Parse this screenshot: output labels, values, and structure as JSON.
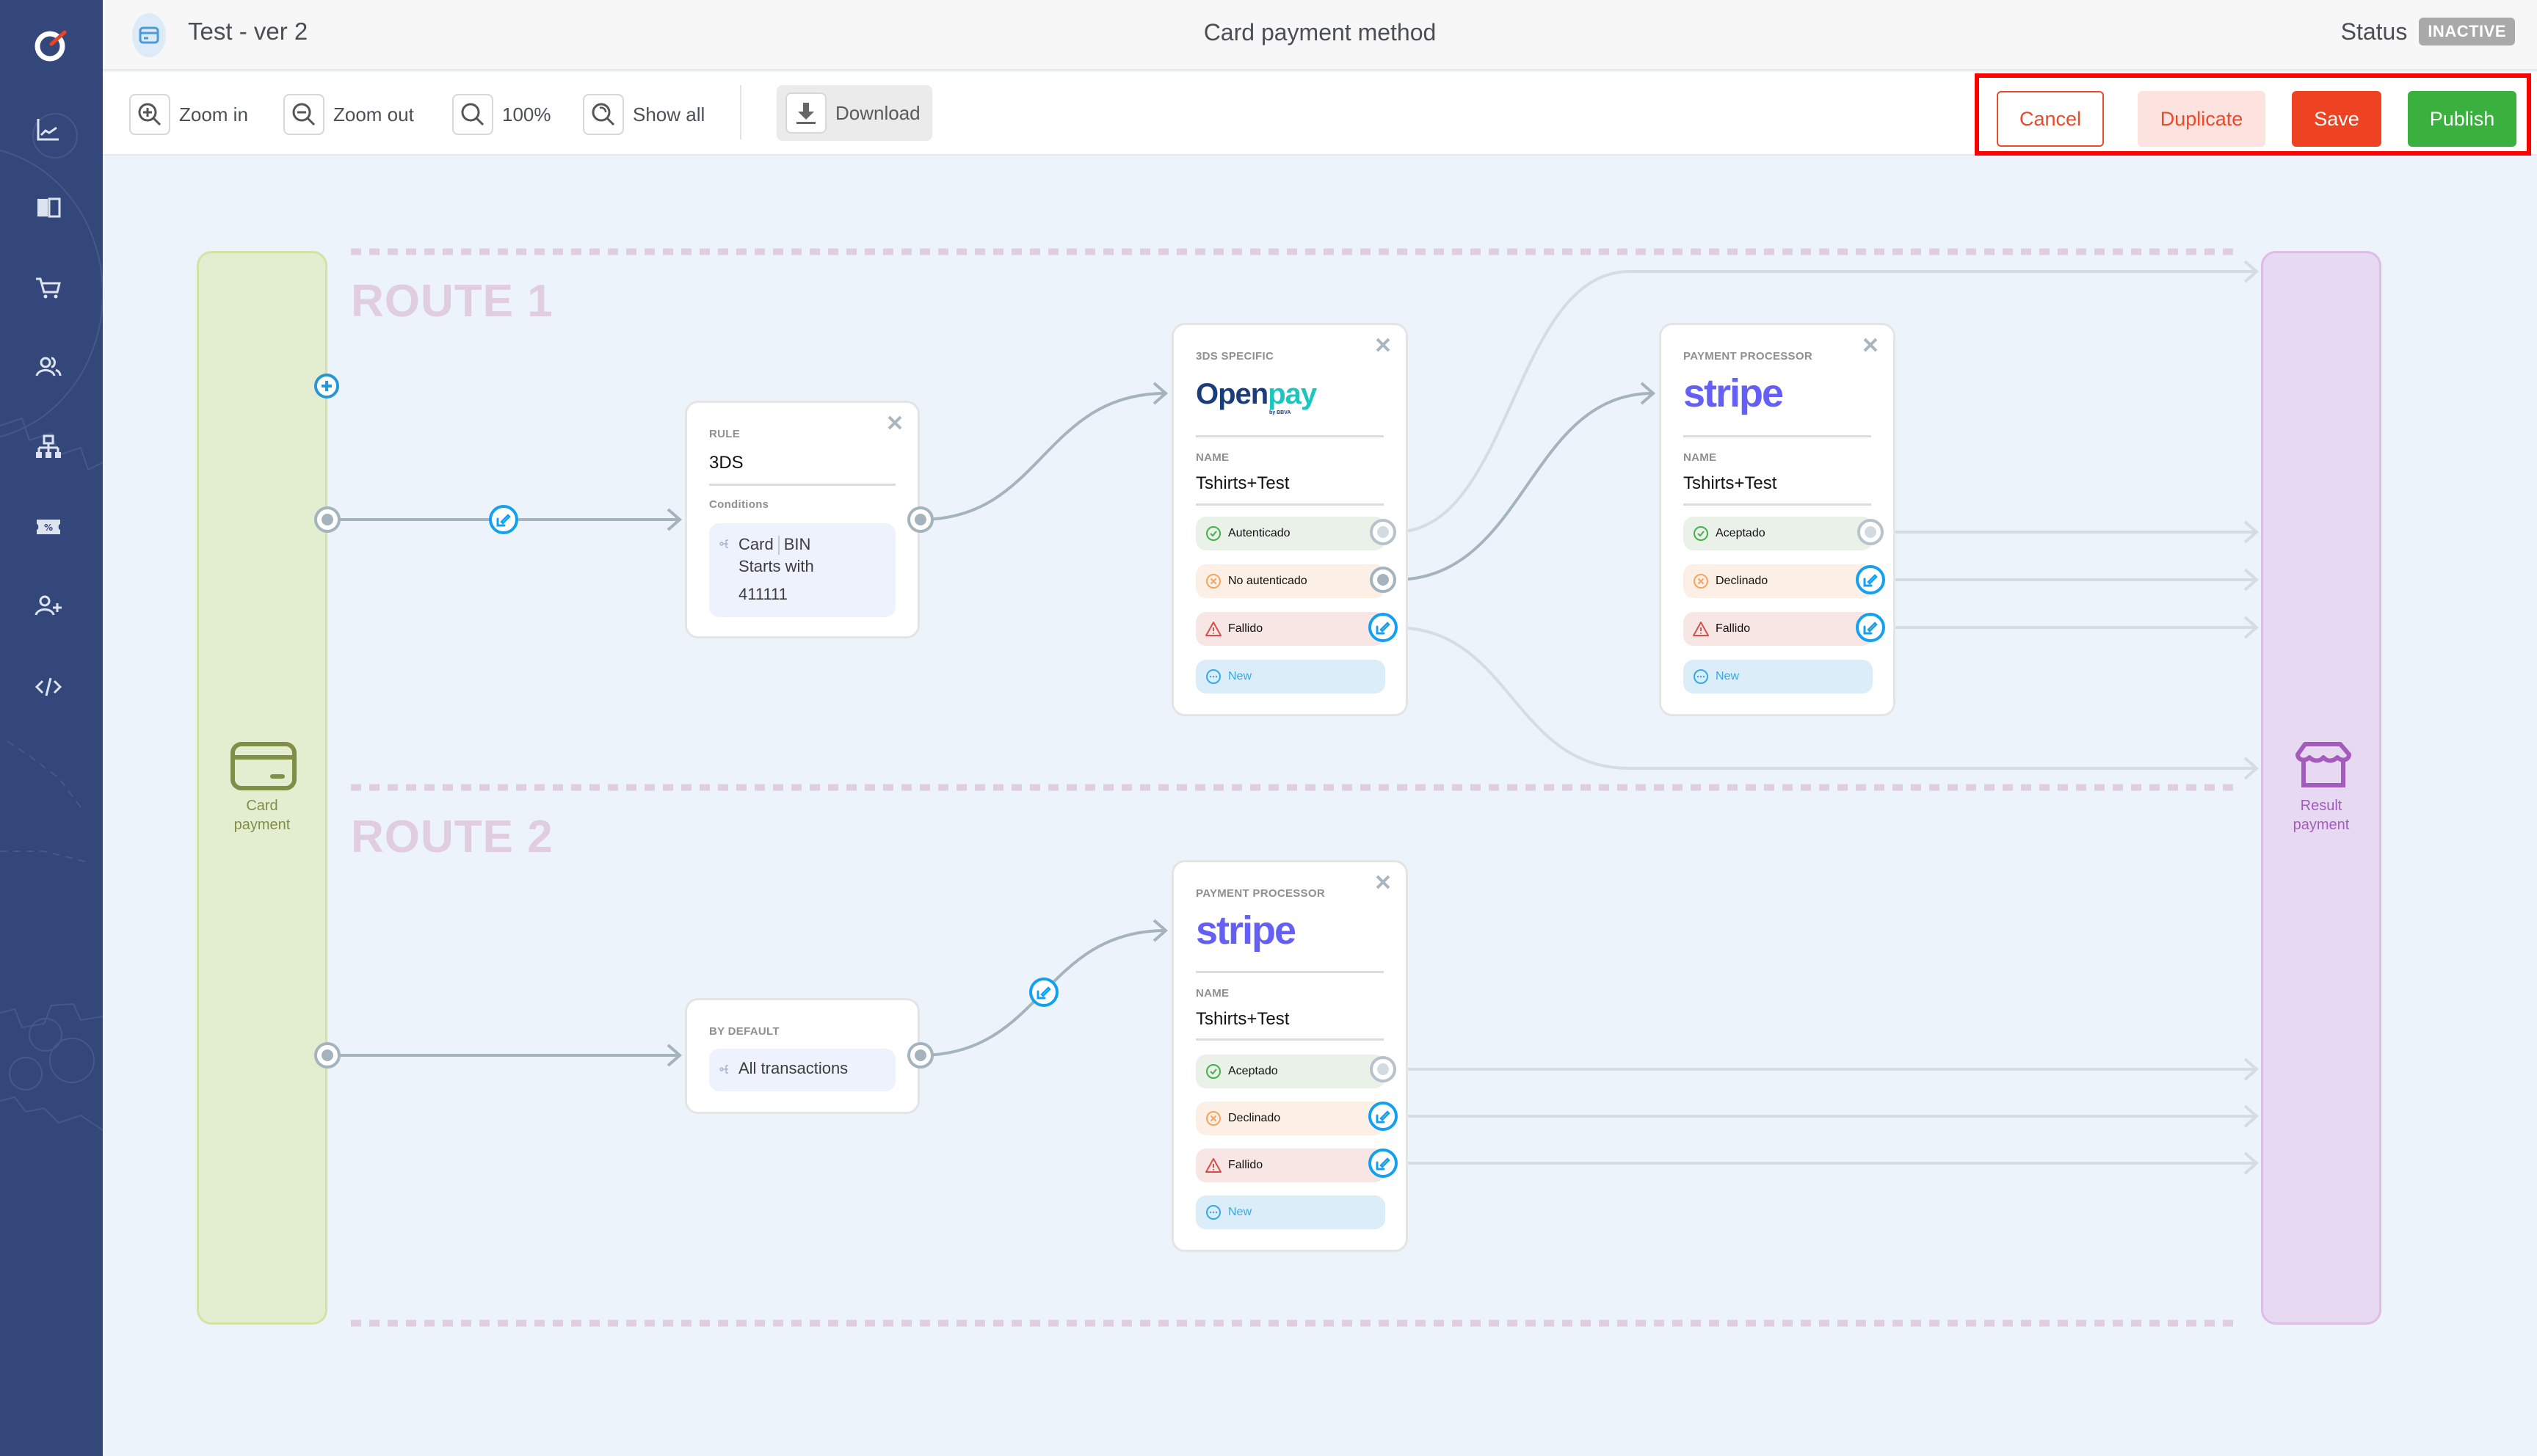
{
  "header": {
    "flow_title": "Test - ver 2",
    "page_title": "Card payment method",
    "status_label": "Status",
    "status_value": "INACTIVE"
  },
  "sidebar": {
    "items": [
      {
        "icon": "chart-line-icon",
        "label": "Analytics"
      },
      {
        "icon": "book-icon",
        "label": "Docs"
      },
      {
        "icon": "cart-icon",
        "label": "Orders"
      },
      {
        "icon": "users-icon",
        "label": "Customers"
      },
      {
        "icon": "sitemap-icon",
        "label": "Routing"
      },
      {
        "icon": "coupon-icon",
        "label": "Discounts"
      },
      {
        "icon": "user-plus-icon",
        "label": "Add user"
      },
      {
        "icon": "code-icon",
        "label": "Developers"
      }
    ]
  },
  "toolbar": {
    "zoom_in": "Zoom in",
    "zoom_out": "Zoom out",
    "zoom_level": "100%",
    "show_all": "Show all",
    "download": "Download"
  },
  "actions": {
    "cancel": "Cancel",
    "duplicate": "Duplicate",
    "save": "Save",
    "publish": "Publish",
    "colors": {
      "cancel": "#e84a2a",
      "save": "#ee4322",
      "publish": "#3ab03e",
      "highlight": "#ff0000"
    }
  },
  "canvas": {
    "start": {
      "label_line1": "Card",
      "label_line2": "payment"
    },
    "end": {
      "label_line1": "Result",
      "label_line2": "payment"
    },
    "routes": [
      {
        "label": "ROUTE 1",
        "rule": {
          "kicker": "RULE",
          "name": "3DS",
          "conditions_label": "Conditions",
          "condition": {
            "field_a": "Card",
            "field_b": "BIN",
            "operator": "Starts with",
            "value": "411111"
          }
        },
        "nodes": [
          {
            "kicker": "3DS SPECIFIC",
            "provider": "Openpay",
            "provider_logo_a": "Open",
            "provider_logo_b": "pay",
            "provider_sub": "by BBVA",
            "name_label": "NAME",
            "name": "Tshirts+Test",
            "outcomes": [
              "Autenticado",
              "No autenticado",
              "Fallido",
              "New"
            ]
          },
          {
            "kicker": "PAYMENT PROCESSOR",
            "provider": "stripe",
            "name_label": "NAME",
            "name": "Tshirts+Test",
            "outcomes": [
              "Aceptado",
              "Declinado",
              "Fallido",
              "New"
            ]
          }
        ]
      },
      {
        "label": "ROUTE 2",
        "rule": {
          "kicker": "BY DEFAULT",
          "condition": {
            "value": "All transactions"
          }
        },
        "nodes": [
          {
            "kicker": "PAYMENT PROCESSOR",
            "provider": "stripe",
            "name_label": "NAME",
            "name": "Tshirts+Test",
            "outcomes": [
              "Aceptado",
              "Declinado",
              "Fallido",
              "New"
            ]
          }
        ]
      }
    ]
  }
}
